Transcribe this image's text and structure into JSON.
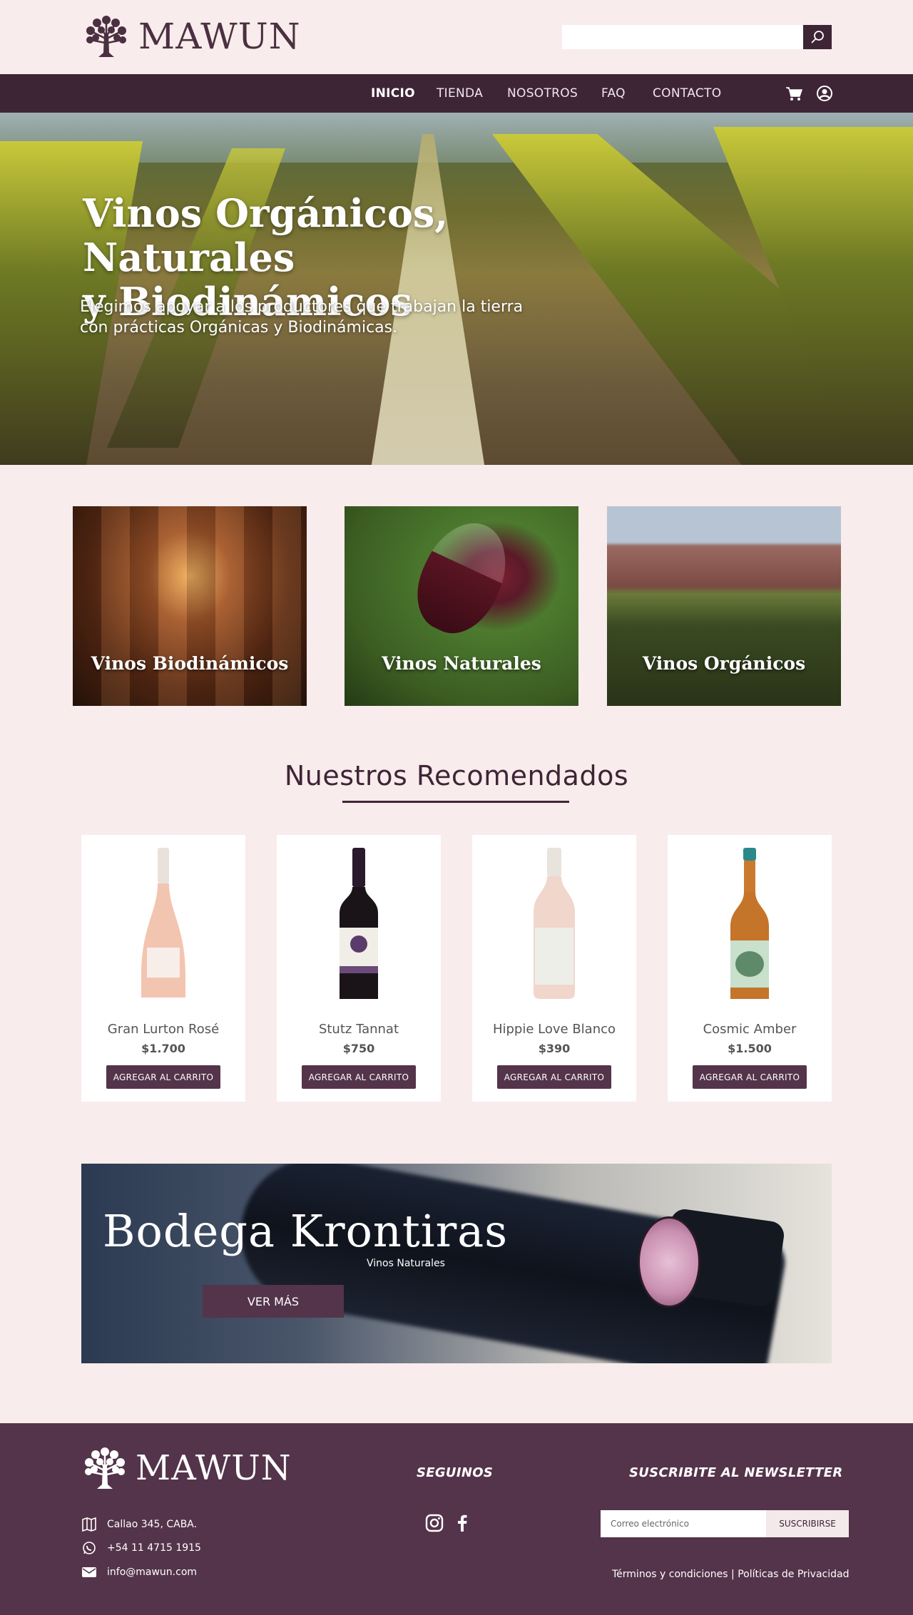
{
  "brand": {
    "name": "MAWUN"
  },
  "search": {
    "placeholder": ""
  },
  "nav": {
    "items": [
      {
        "label": "INICIO",
        "active": true
      },
      {
        "label": "TIENDA"
      },
      {
        "label": "NOSOTROS"
      },
      {
        "label": "FAQ"
      },
      {
        "label": "CONTACTO"
      }
    ],
    "icons": [
      "cart-icon",
      "user-icon"
    ]
  },
  "hero": {
    "title_line1": "Vinos Orgánicos, Naturales",
    "title_line2": "y Biodinámicos",
    "subtitle_line1": "Elegimos apoyar a los productores que trabajan la tierra",
    "subtitle_line2": "con prácticas Orgánicas y Biodinámicas."
  },
  "categories": [
    {
      "label": "Vinos Biodinámicos"
    },
    {
      "label": "Vinos Naturales"
    },
    {
      "label": "Vinos Orgánicos"
    }
  ],
  "recommended": {
    "title": "Nuestros Recomendados",
    "products": [
      {
        "name": "Gran Lurton Rosé",
        "price": "$1.700",
        "button": "AGREGAR AL CARRITO"
      },
      {
        "name": "Stutz Tannat",
        "price": "$750",
        "button": "AGREGAR AL CARRITO"
      },
      {
        "name": "Hippie Love Blanco",
        "price": "$390",
        "button": "AGREGAR AL CARRITO"
      },
      {
        "name": "Cosmic Amber",
        "price": "$1.500",
        "button": "AGREGAR AL CARRITO"
      }
    ]
  },
  "banner": {
    "title": "Bodega Krontiras",
    "subtitle": "Vinos Naturales",
    "button": "VER MÁS"
  },
  "footer": {
    "social_heading": "SEGUINOS",
    "newsletter_heading": "SUSCRIBITE AL NEWSLETTER",
    "address": "Callao 345, CABA.",
    "phone": "+54 11 4715 1915",
    "email": "info@mawun.com",
    "newsletter_placeholder": "Correo electrónico",
    "newsletter_button": "SUSCRIBIRSE",
    "legal": "Términos y condiciones | Políticas de Privacidad"
  },
  "colors": {
    "background": "#f9ecec",
    "primary": "#3e2536",
    "footer": "#54344a",
    "button": "#54344a"
  }
}
